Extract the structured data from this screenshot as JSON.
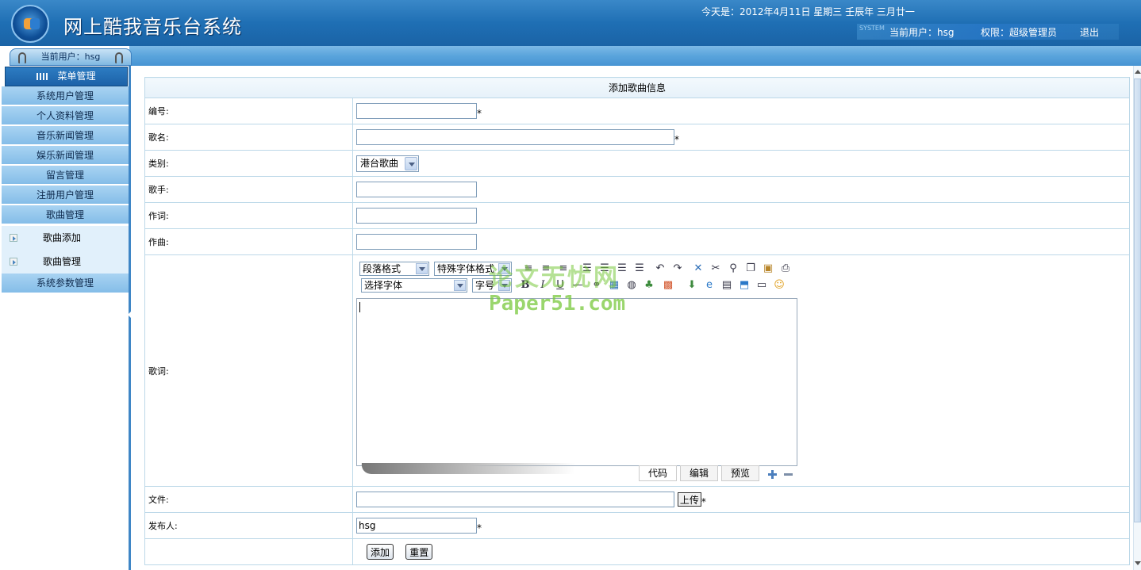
{
  "header": {
    "title": "网上酷我音乐台系统",
    "date": "今天是：2012年4月11日 星期三 壬辰年 三月廿一",
    "system_tag": "SYSTEM",
    "current_user": "当前用户：hsg",
    "permission": "权限：超级管理员",
    "logout": "退出"
  },
  "sidebar": {
    "user_tab": "当前用户：hsg",
    "menu_head": "菜单管理",
    "items": [
      {
        "label": "系统用户管理"
      },
      {
        "label": "个人资料管理"
      },
      {
        "label": "音乐新闻管理"
      },
      {
        "label": "娱乐新闻管理"
      },
      {
        "label": "留言管理"
      },
      {
        "label": "注册用户管理"
      },
      {
        "label": "歌曲管理"
      }
    ],
    "sub_items": [
      {
        "label": "歌曲添加"
      },
      {
        "label": "歌曲管理"
      }
    ],
    "last_item": "系统参数管理"
  },
  "form": {
    "caption": "添加歌曲信息",
    "fields": {
      "id": {
        "label": "编号:",
        "value": ""
      },
      "name": {
        "label": "歌名:",
        "value": ""
      },
      "category": {
        "label": "类别:",
        "value": "港台歌曲"
      },
      "singer": {
        "label": "歌手:",
        "value": ""
      },
      "lyricist": {
        "label": "作词:",
        "value": ""
      },
      "composer": {
        "label": "作曲:",
        "value": ""
      },
      "lyrics": {
        "label": "歌词:"
      },
      "file": {
        "label": "文件:",
        "value": "",
        "upload": "上传"
      },
      "publisher": {
        "label": "发布人:",
        "value": "hsg"
      }
    },
    "required_mark": "*",
    "buttons": {
      "add": "添加",
      "reset": "重置"
    }
  },
  "editor": {
    "paragraph_format": "段落格式",
    "special_format": "特殊字体格式",
    "font": "选择字体",
    "font_size": "字号",
    "tabs": {
      "code": "代码",
      "edit": "编辑",
      "preview": "预览"
    }
  },
  "watermark": {
    "line1": "论文无忧网",
    "line2": "Paper51.com"
  }
}
